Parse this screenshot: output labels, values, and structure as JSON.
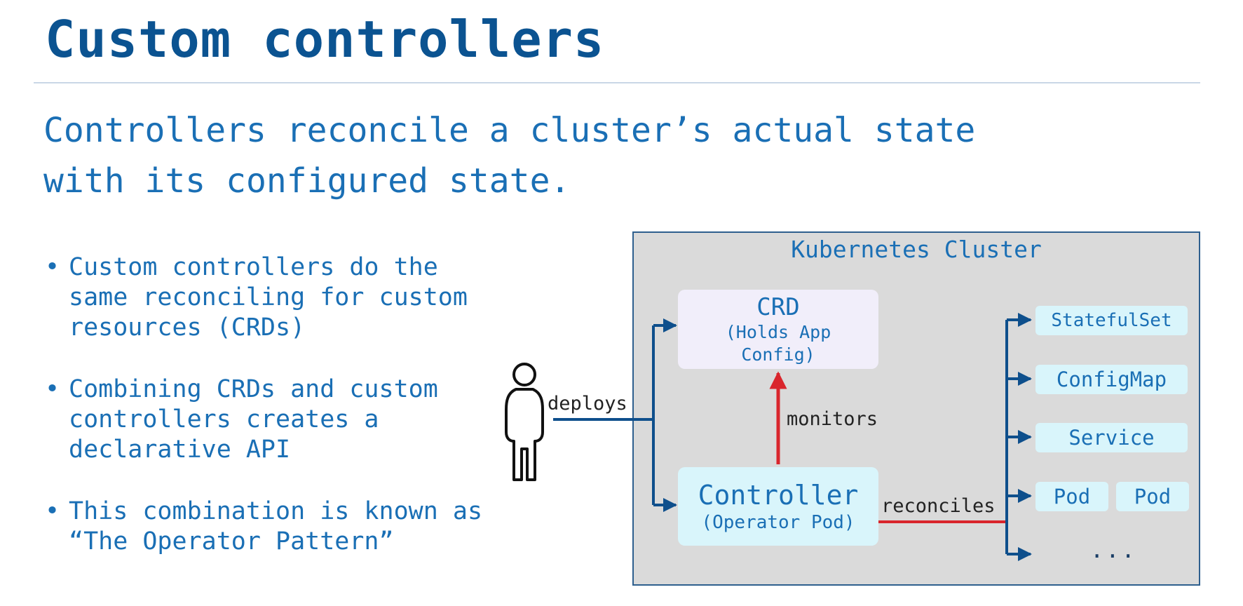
{
  "title": "Custom controllers",
  "subtitle": {
    "line1": "Controllers reconcile a cluster’s actual state",
    "line2": "with its configured state."
  },
  "bullets": [
    "Custom controllers do the same reconciling for custom resources (CRDs)",
    "Combining CRDs and custom controllers creates a declarative API",
    "This combination is known as “The Operator Pattern”"
  ],
  "diagram": {
    "cluster_title": "Kubernetes Cluster",
    "crd": {
      "title": "CRD",
      "sub_line1": "(Holds App",
      "sub_line2": "Config)"
    },
    "controller": {
      "title": "Controller",
      "sub": "(Operator Pod)"
    },
    "labels": {
      "deploys": "deploys",
      "monitors": "monitors",
      "reconciles": "reconciles"
    },
    "resources": [
      "StatefulSet",
      "ConfigMap",
      "Service",
      "Pod",
      "Pod"
    ],
    "ellipsis": "...",
    "colors": {
      "blue_arrow": "#0e4f8c",
      "red_arrow": "#d9252c",
      "cluster_bg": "#dadada"
    }
  }
}
